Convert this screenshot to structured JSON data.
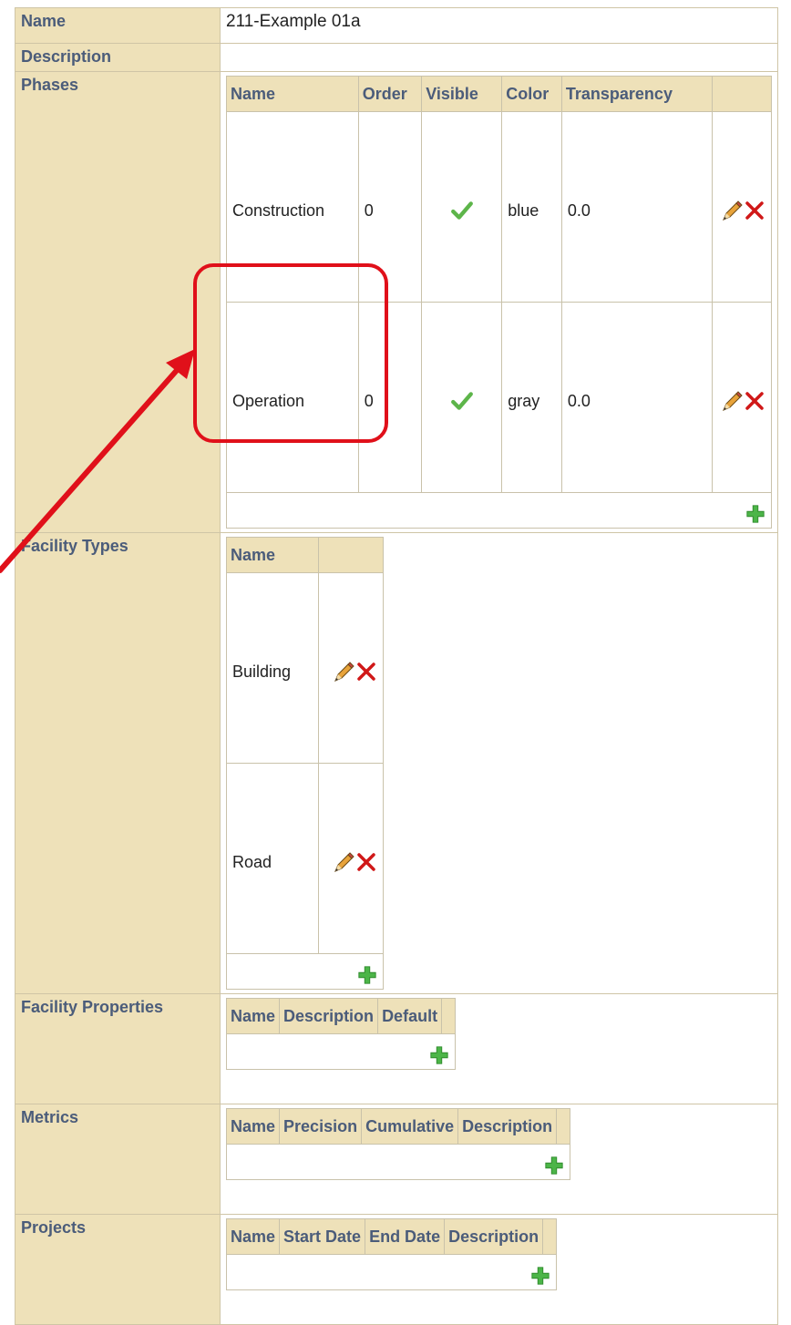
{
  "rows": {
    "name": {
      "label": "Name",
      "value": "211-Example 01a"
    },
    "description": {
      "label": "Description",
      "value": ""
    },
    "phases": {
      "label": "Phases",
      "headers": [
        "Name",
        "Order",
        "Visible",
        "Color",
        "Transparency"
      ],
      "items": [
        {
          "name": "Construction",
          "order": "0",
          "visible": true,
          "color": "blue",
          "transparency": "0.0"
        },
        {
          "name": "Operation",
          "order": "0",
          "visible": true,
          "color": "gray",
          "transparency": "0.0"
        }
      ]
    },
    "facility_types": {
      "label": "Facility Types",
      "headers": [
        "Name"
      ],
      "items": [
        "Building",
        "Road"
      ]
    },
    "facility_properties": {
      "label": "Facility Properties",
      "headers": [
        "Name",
        "Description",
        "Default"
      ]
    },
    "metrics": {
      "label": "Metrics",
      "headers": [
        "Name",
        "Precision",
        "Cumulative",
        "Description"
      ]
    },
    "projects": {
      "label": "Projects",
      "headers": [
        "Name",
        "Start Date",
        "End Date",
        "Description"
      ]
    }
  },
  "icons": {
    "edit": "pencil-icon",
    "delete": "red-x-icon",
    "add": "green-plus-icon",
    "visible": "green-check-icon"
  },
  "colors": {
    "header_bg": "#EEE1B9",
    "header_text": "#4B5C7A",
    "annotation": "#E0101A"
  }
}
